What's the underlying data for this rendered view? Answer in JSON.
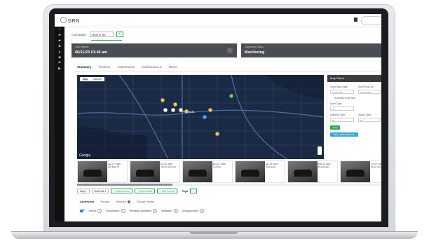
{
  "header": {
    "logo": "DRN"
  },
  "sidebar": {
    "items": [
      "⌕",
      "▰",
      "▰",
      "♟",
      "▲",
      "◆",
      "⚑",
      "▶"
    ]
  },
  "campaign": {
    "label": "Campaign:",
    "value": "Tesla in Ne",
    "add_label": "+"
  },
  "cards": [
    {
      "label": "Last Sighted",
      "value": "06/11/23 01:45 am"
    },
    {
      "label": "Campaign Status",
      "value": "Monitoring"
    }
  ],
  "tabs": [
    "Summary",
    "Timeline",
    "Attachments",
    "Notifications 2",
    "Notes"
  ],
  "map": {
    "modes": [
      "Map",
      "Satellite"
    ],
    "city_label": "Phoenix",
    "google": "Google",
    "markers": [
      {
        "color": "#f0c060"
      },
      {
        "color": "#f0c060"
      },
      {
        "color": "#f0c060"
      },
      {
        "color": "#f0c060"
      },
      {
        "color": "#5fd06a"
      },
      {
        "color": "#ffffff"
      },
      {
        "color": "#ffffff"
      },
      {
        "color": "#ffffff"
      },
      {
        "color": "#4aa3ff"
      },
      {
        "color": "#f0c060"
      }
    ]
  },
  "filters": {
    "title": "Map Filters",
    "start_label": "Scan Start Date",
    "end_label": "Scan End Dat",
    "start_value": "01/11/2020",
    "end_value": "06/11/2023",
    "checkbox_label": "Scanned in the last",
    "scan_type_label": "Scan Type",
    "scan_type_value": "All",
    "address_type_label": "Address Type",
    "status_type_label": "Status Type",
    "address_value": "All",
    "status_value": "All",
    "apply_label": "Apply",
    "select_label": "Filter Visible Map Area"
  },
  "thumbs": [
    {
      "date": "Sep 17, 2020",
      "loc": "123 Main St"
    },
    {
      "date": "Oct 03, 2020",
      "loc": "Vehicle detected"
    },
    {
      "date": "Dec 01, 2020",
      "loc": "Location"
    },
    {
      "date": "Jan 14, 2021",
      "loc": "Parking lot"
    },
    {
      "date": "Mar 22, 2021",
      "loc": "Residential"
    },
    {
      "date": "Jun 07, 2021",
      "loc": "Street view"
    }
  ],
  "toolbar": {
    "buttons": [
      "Map ▾",
      "Bulk Edit ▾",
      "+ Add Address",
      "+ Add Vehicle",
      "+ Add Person"
    ],
    "tags_label": "Tags",
    "tag_add": "+"
  },
  "subtabs": [
    "Addresses",
    "People",
    "Vehicles",
    "Google Scans"
  ],
  "status": [
    {
      "label": "Active",
      "q": "?"
    },
    {
      "label": "Encounters",
      "q": "?"
    },
    {
      "label": "Pending Validation",
      "q": "?"
    },
    {
      "label": "Validated",
      "q": "?"
    },
    {
      "label": "Unsuspended",
      "q": "?"
    }
  ]
}
